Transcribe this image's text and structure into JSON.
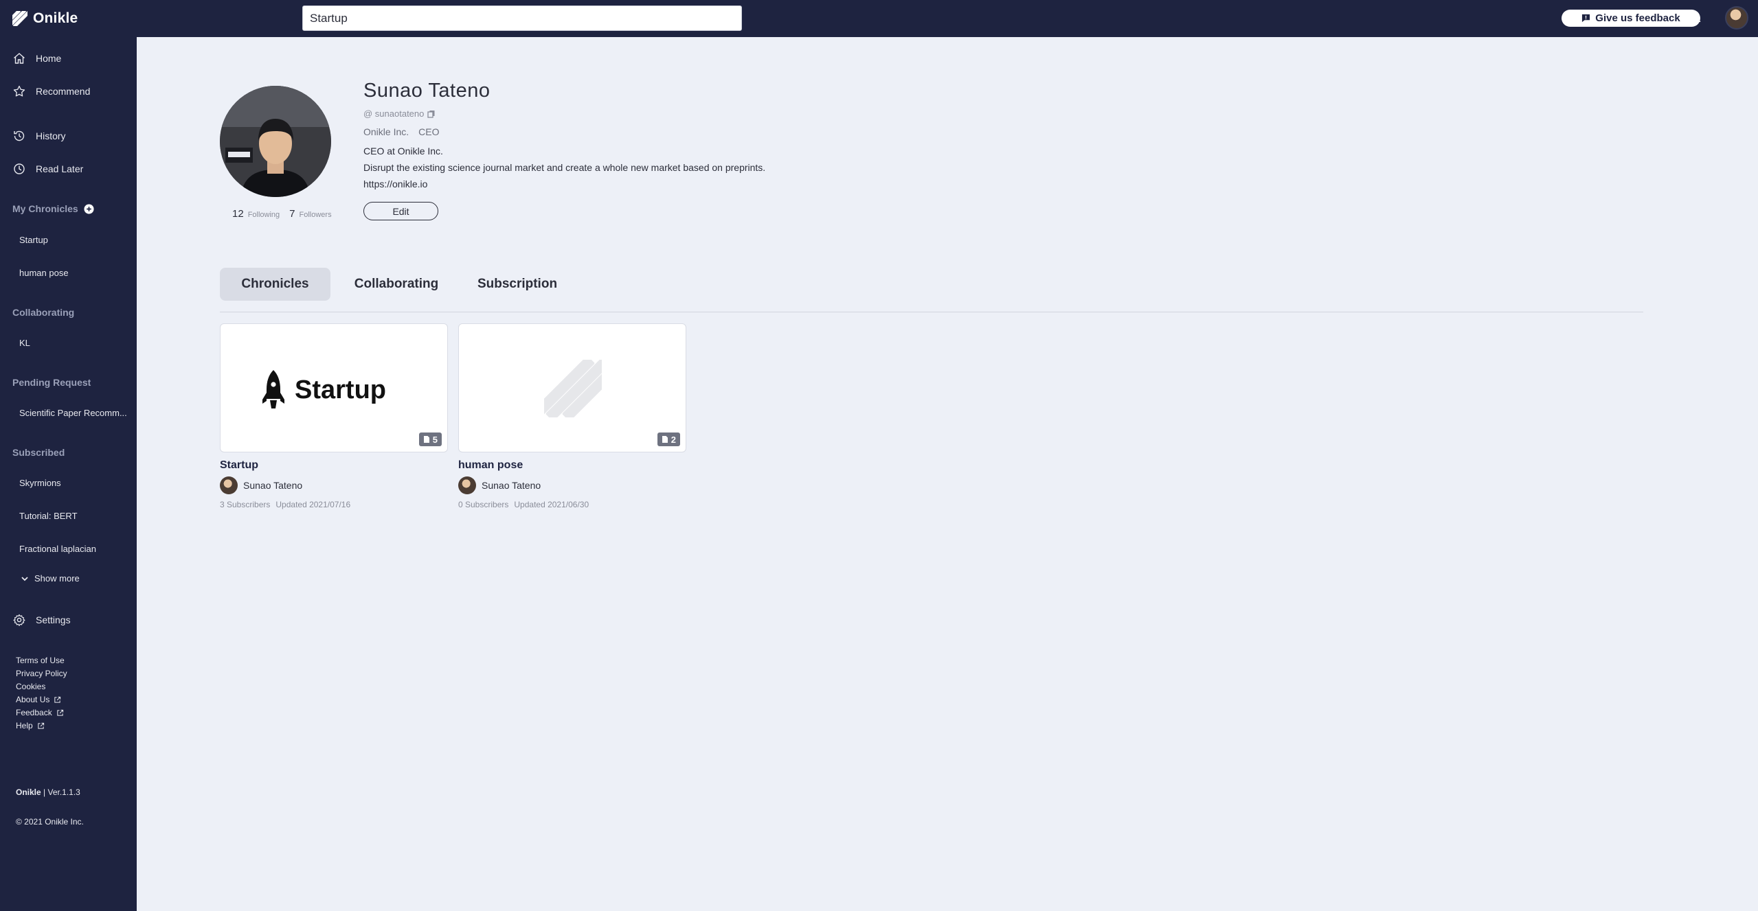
{
  "app": {
    "name": "Onikle",
    "search_value": "Startup",
    "feedback_label": "Give us feedback"
  },
  "sidebar": {
    "nav": [
      {
        "label": "Home",
        "icon": "home-icon"
      },
      {
        "label": "Recommend",
        "icon": "star-icon"
      },
      {
        "label": "History",
        "icon": "history-icon"
      },
      {
        "label": "Read Later",
        "icon": "clock-icon"
      }
    ],
    "my_chronicles": {
      "heading": "My Chronicles",
      "items": [
        "Startup",
        "human pose"
      ]
    },
    "collaborating": {
      "heading": "Collaborating",
      "items": [
        "KL"
      ]
    },
    "pending_request": {
      "heading": "Pending Request",
      "items": [
        "Scientific Paper Recomm..."
      ]
    },
    "subscribed": {
      "heading": "Subscribed",
      "items": [
        "Skyrmions",
        "Tutorial: BERT",
        "Fractional laplacian"
      ],
      "show_more": "Show more"
    },
    "settings_label": "Settings",
    "footer_links": [
      "Terms of Use",
      "Privacy Policy",
      "Cookies",
      "About Us",
      "Feedback",
      "Help"
    ],
    "brand": "Onikle",
    "version": "| Ver.1.1.3",
    "copyright": "© 2021 Onikle Inc."
  },
  "profile": {
    "name": "Sunao  Tateno",
    "handle": "@ sunaotateno",
    "company": "Onikle Inc.",
    "role": "CEO",
    "headline": "CEO at Onikle Inc.",
    "bio": "Disrupt the existing science journal market and create a whole new market based on preprints.",
    "website": "https://onikle.io",
    "edit_label": "Edit",
    "following_count": "12",
    "following_label": "Following",
    "followers_count": "7",
    "followers_label": "Followers"
  },
  "tabs": [
    {
      "label": "Chronicles",
      "active": true
    },
    {
      "label": "Collaborating",
      "active": false
    },
    {
      "label": "Subscription",
      "active": false
    }
  ],
  "chronicles": [
    {
      "title": "Startup",
      "thumb_text": "Startup",
      "count": "5",
      "author": "Sunao Tateno",
      "subscribers": "3 Subscribers",
      "updated": "Updated 2021/07/16"
    },
    {
      "title": "human pose",
      "count": "2",
      "author": "Sunao Tateno",
      "subscribers": "0 Subscribers",
      "updated": "Updated 2021/06/30"
    }
  ],
  "colors": {
    "sidebar_bg": "#1e2340",
    "page_bg": "#edf0f7",
    "active_tab_bg": "#d9dce5"
  }
}
